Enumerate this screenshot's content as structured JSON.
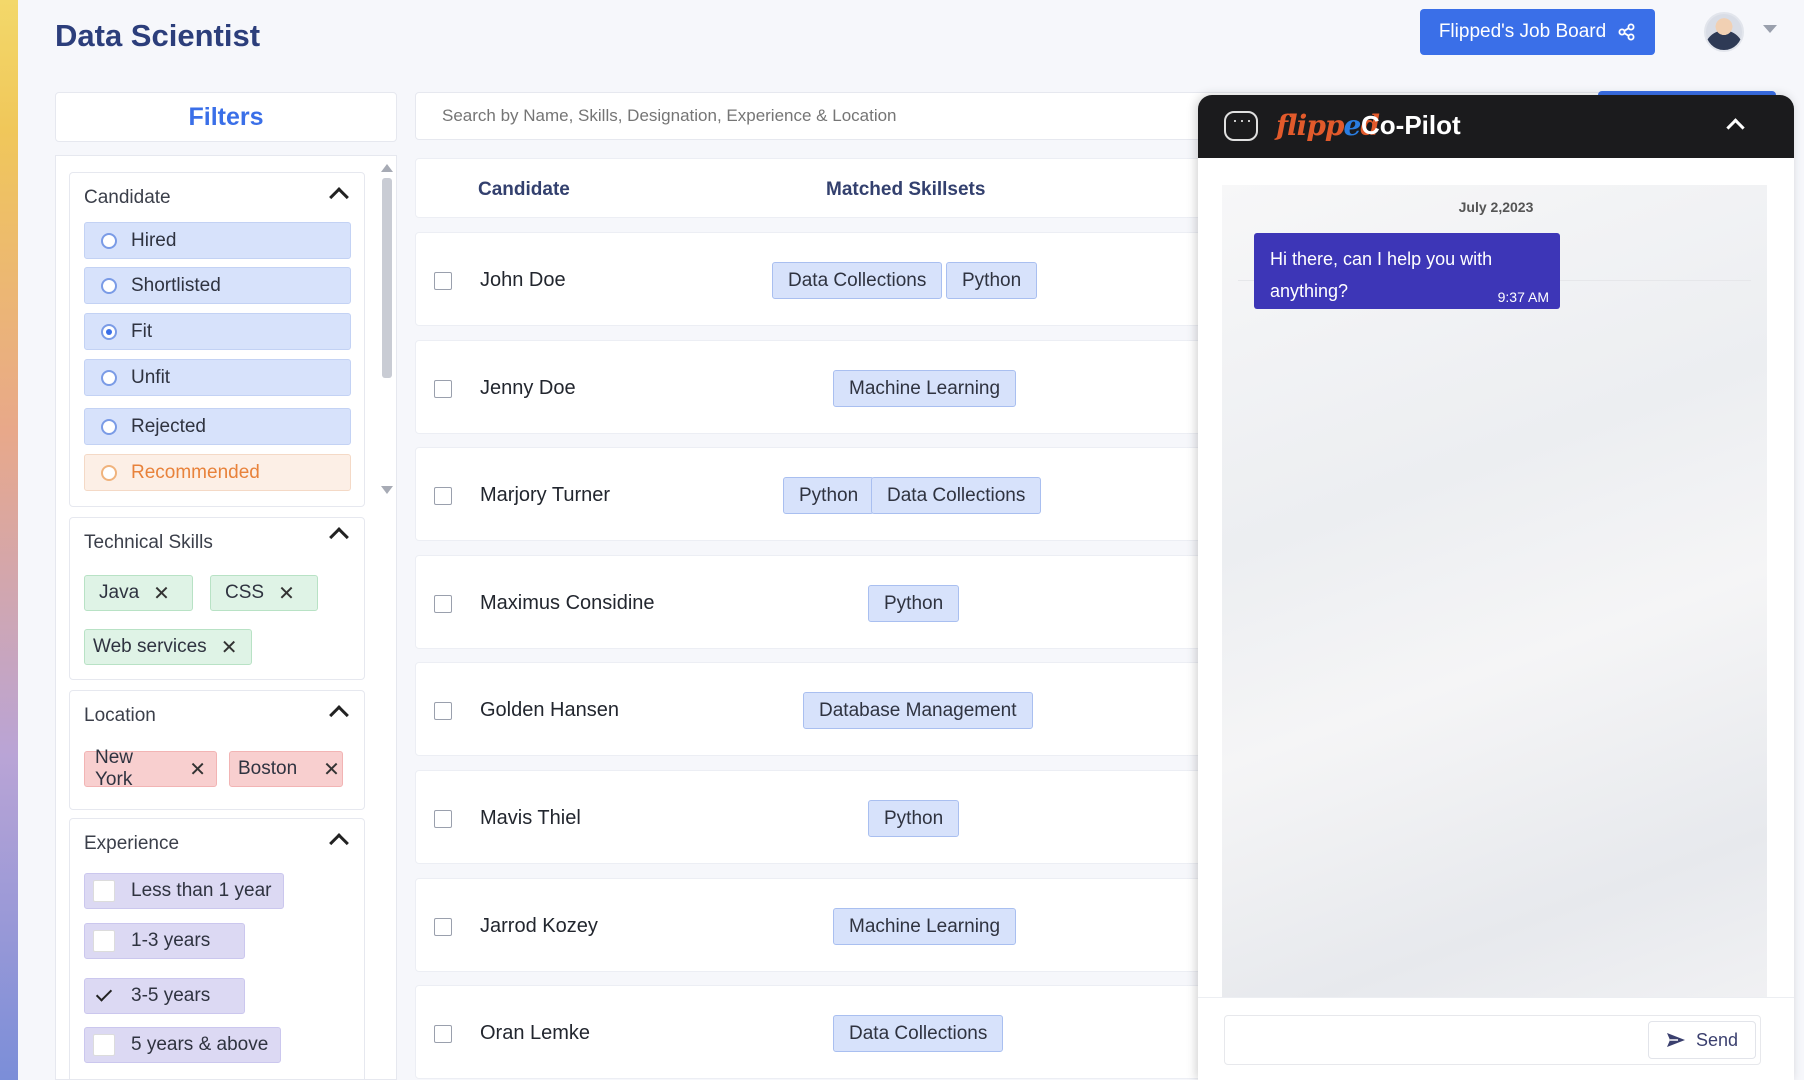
{
  "header": {
    "page_title": "Data Scientist",
    "job_board_label": "Flipped's Job Board"
  },
  "filters": {
    "title": "Filters",
    "candidate": {
      "title": "Candidate",
      "options": [
        {
          "label": "Hired",
          "selected": false
        },
        {
          "label": "Shortlisted",
          "selected": false
        },
        {
          "label": "Fit",
          "selected": true
        },
        {
          "label": "Unfit",
          "selected": false
        },
        {
          "label": "Rejected",
          "selected": false
        },
        {
          "label": "Recommended",
          "selected": false
        }
      ]
    },
    "technical_skills": {
      "title": "Technical Skills",
      "chips": [
        "Java",
        "CSS",
        "Web services"
      ]
    },
    "location": {
      "title": "Location",
      "chips": [
        "New York",
        "Boston"
      ]
    },
    "experience": {
      "title": "Experience",
      "options": [
        {
          "label": "Less than 1 year",
          "checked": false
        },
        {
          "label": "1-3 years",
          "checked": false
        },
        {
          "label": "3-5 years",
          "checked": true
        },
        {
          "label": "5 years & above",
          "checked": false
        }
      ]
    }
  },
  "search": {
    "placeholder": "Search by Name, Skills, Designation, Experience & Location"
  },
  "table": {
    "columns": [
      "Candidate",
      "Matched Skillsets"
    ],
    "rows": [
      {
        "name": "John Doe",
        "skills": [
          "Data Collections",
          "Python"
        ]
      },
      {
        "name": "Jenny Doe",
        "skills": [
          "Machine Learning"
        ]
      },
      {
        "name": "Marjory Turner",
        "skills": [
          "Python",
          "Data Collections"
        ]
      },
      {
        "name": "Maximus Considine",
        "skills": [
          "Python"
        ]
      },
      {
        "name": "Golden Hansen",
        "skills": [
          "Database Management"
        ]
      },
      {
        "name": "Mavis Thiel",
        "skills": [
          "Python"
        ]
      },
      {
        "name": "Jarrod Kozey",
        "skills": [
          "Machine Learning"
        ]
      },
      {
        "name": "Oran Lemke",
        "skills": [
          "Data Collections"
        ]
      }
    ]
  },
  "copilot": {
    "logo_text": "flipped",
    "title": "Co-Pilot",
    "date": "July 2,2023",
    "messages": [
      {
        "text": "Hi there, can I help you with anything?",
        "time": "9:37 AM"
      }
    ],
    "send_label": "Send"
  },
  "colors": {
    "accent": "#3a6fe8",
    "title": "#2c3e7b",
    "copilot_header": "#1b1b1d",
    "bubble": "#3d36b7",
    "recommended": "#e8823b"
  }
}
